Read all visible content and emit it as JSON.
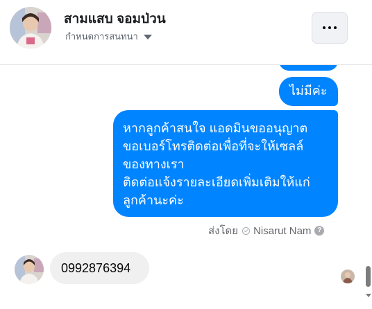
{
  "header": {
    "contact_name": "สามแสบ จอมป่วน",
    "subtitle": "กำหนดการสนทนา",
    "more_label": "..."
  },
  "messages": {
    "outgoing": [
      {
        "text": "ไม่มีค่ะ"
      },
      {
        "text": "หากลูกค้าสนใจ แอดมินขออนุญาต\nขอเบอร์โทรติดต่อเพื่อที่จะให้เซลล์\nของทางเรา\nติดต่อแจ้งรายละเอียดเพิ่มเติมให้แก่\nลูกค้านะค่ะ"
      }
    ],
    "sent_by_label": "ส่งโดย",
    "sent_by_name": "Nisarut Nam",
    "help_glyph": "?",
    "incoming": [
      {
        "text": "0992876394"
      }
    ]
  },
  "colors": {
    "outgoing_bubble": "#0084ff",
    "incoming_bubble": "#f0f0f0"
  },
  "icons": [
    "dropdown-caret-icon",
    "more-options-icon",
    "sent-check-icon",
    "help-icon"
  ]
}
